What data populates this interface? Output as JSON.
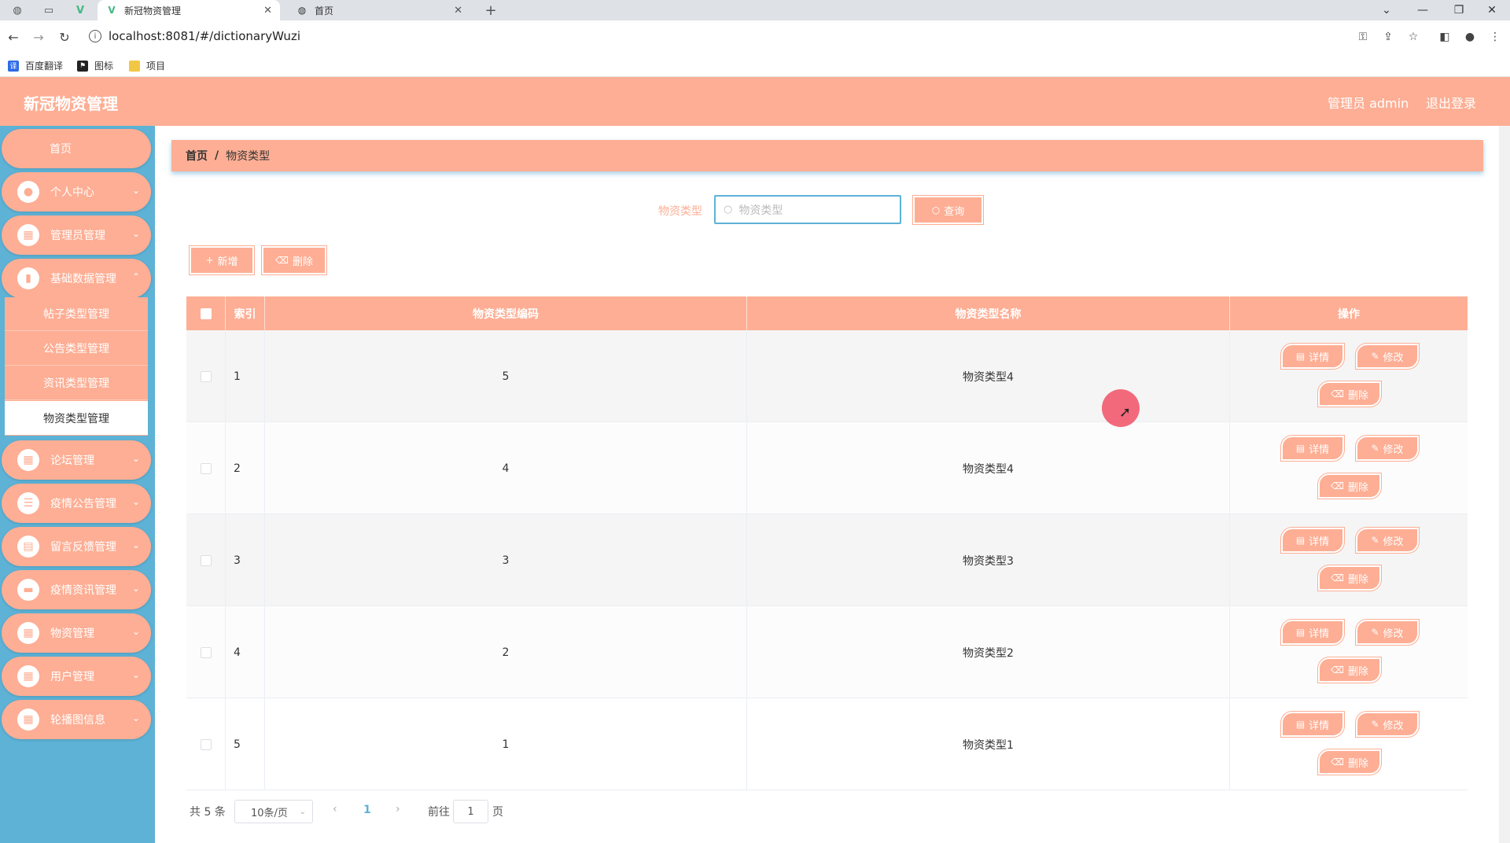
{
  "browser": {
    "tabs": [
      {
        "title": "新冠物资管理",
        "active": true
      },
      {
        "title": "首页",
        "active": false
      }
    ],
    "new_tab_glyph": "+",
    "url": "localhost:8081/#/dictionaryWuzi",
    "bookmarks": [
      {
        "label": "百度翻译",
        "color": "#2e6be6"
      },
      {
        "label": "图标",
        "color": "#222222"
      },
      {
        "label": "项目",
        "color": "#f2c744"
      }
    ]
  },
  "header": {
    "title": "新冠物资管理",
    "user": "管理员 admin",
    "logout": "退出登录"
  },
  "sidebar": {
    "home": "首页",
    "items": [
      {
        "label": "个人中心",
        "icon": "user-icon"
      },
      {
        "label": "管理员管理",
        "icon": "grid-icon"
      },
      {
        "label": "基础数据管理",
        "icon": "chart-icon"
      },
      {
        "label": "论坛管理",
        "icon": "grid-icon"
      },
      {
        "label": "疫情公告管理",
        "icon": "sliders-icon"
      },
      {
        "label": "留言反馈管理",
        "icon": "clipboard-icon"
      },
      {
        "label": "疫情资讯管理",
        "icon": "monitor-icon"
      },
      {
        "label": "物资管理",
        "icon": "grid-icon"
      },
      {
        "label": "用户管理",
        "icon": "grid-icon"
      },
      {
        "label": "轮播图信息",
        "icon": "grid-icon"
      }
    ],
    "submenu": [
      {
        "label": "帖子类型管理",
        "active": false
      },
      {
        "label": "公告类型管理",
        "active": false
      },
      {
        "label": "资讯类型管理",
        "active": false
      },
      {
        "label": "物资类型管理",
        "active": true
      }
    ]
  },
  "breadcrumb": {
    "home": "首页",
    "separator": "/",
    "current": "物资类型"
  },
  "search": {
    "label": "物资类型",
    "placeholder": "物资类型",
    "button": "查询"
  },
  "actions": {
    "add": "新增",
    "delete": "删除"
  },
  "table": {
    "columns": [
      "索引",
      "物资类型编码",
      "物资类型名称",
      "操作"
    ],
    "rows": [
      {
        "index": "1",
        "code": "5",
        "name": "物资类型4"
      },
      {
        "index": "2",
        "code": "4",
        "name": "物资类型4"
      },
      {
        "index": "3",
        "code": "3",
        "name": "物资类型3"
      },
      {
        "index": "4",
        "code": "2",
        "name": "物资类型2"
      },
      {
        "index": "5",
        "code": "1",
        "name": "物资类型1"
      }
    ],
    "row_actions": {
      "detail": "详情",
      "edit": "修改",
      "delete": "删除"
    }
  },
  "pagination": {
    "total": "共 5 条",
    "page_size": "10条/页",
    "current_page": "1",
    "goto_label": "前往",
    "goto_value": "1",
    "page_suffix": "页"
  },
  "colors": {
    "accent": "#fdae94",
    "sidebar_bg": "#5db2d6"
  }
}
